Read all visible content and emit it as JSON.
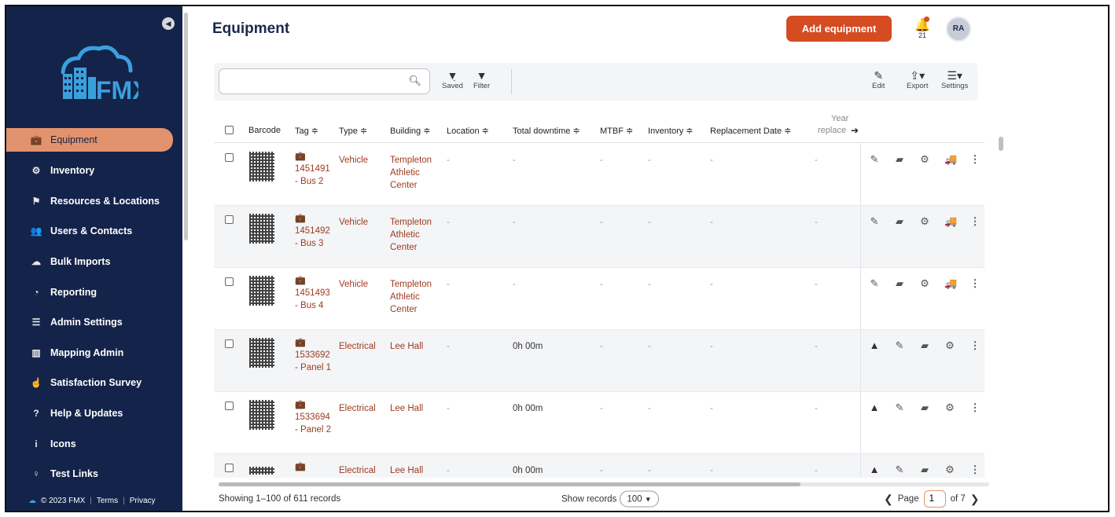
{
  "sidebar": {
    "logo_text": "FMX",
    "items": [
      {
        "label": "Equipment",
        "icon": "briefcase-icon",
        "glyph": "💼",
        "active": true
      },
      {
        "label": "Inventory",
        "icon": "cubes-icon",
        "glyph": "⚙"
      },
      {
        "label": "Resources & Locations",
        "icon": "flag-icon",
        "glyph": "⚑"
      },
      {
        "label": "Users & Contacts",
        "icon": "users-icon",
        "glyph": "👥"
      },
      {
        "label": "Bulk Imports",
        "icon": "cloud-upload-icon",
        "glyph": "☁"
      },
      {
        "label": "Reporting",
        "icon": "pie-chart-icon",
        "glyph": "◔"
      },
      {
        "label": "Admin Settings",
        "icon": "sliders-icon",
        "glyph": "☰"
      },
      {
        "label": "Mapping Admin",
        "icon": "map-icon",
        "glyph": "▥"
      },
      {
        "label": "Satisfaction Survey",
        "icon": "thumbs-up-icon",
        "glyph": "☝"
      },
      {
        "label": "Help & Updates",
        "icon": "question-icon",
        "glyph": "?"
      },
      {
        "label": "Icons",
        "icon": "info-icon",
        "glyph": "i"
      },
      {
        "label": "Test Links",
        "icon": "lightbulb-icon",
        "glyph": "♀"
      }
    ],
    "footer": {
      "copyright": "© 2023 FMX",
      "terms": "Terms",
      "privacy": "Privacy"
    }
  },
  "header": {
    "title": "Equipment",
    "add_button": "Add equipment",
    "notification_count": "21",
    "avatar_initials": "RA"
  },
  "toolbar": {
    "search_value": "",
    "saved_label": "Saved",
    "filter_label": "Filter",
    "edit_label": "Edit",
    "export_label": "Export",
    "settings_label": "Settings"
  },
  "table": {
    "columns": [
      "Barcode",
      "Tag ≑",
      "Type ≑",
      "Building ≑",
      "Location ≑",
      "Total downtime ≑",
      "MTBF ≑",
      "Inventory ≑",
      "Replacement Date ≑",
      "Year",
      "replace"
    ],
    "rows": [
      {
        "tag_id": "1451491",
        "tag_name": "- Bus 2",
        "type": "Vehicle",
        "building": [
          "Templeton",
          "Athletic",
          "Center"
        ],
        "location": "-",
        "downtime": "-",
        "mtbf": "-",
        "inventory": "-",
        "replacement": "-",
        "year": "-",
        "warning": false
      },
      {
        "tag_id": "1451492",
        "tag_name": "- Bus 3",
        "type": "Vehicle",
        "building": [
          "Templeton",
          "Athletic",
          "Center"
        ],
        "location": "-",
        "downtime": "-",
        "mtbf": "-",
        "inventory": "-",
        "replacement": "-",
        "year": "-",
        "warning": false
      },
      {
        "tag_id": "1451493",
        "tag_name": "- Bus 4",
        "type": "Vehicle",
        "building": [
          "Templeton",
          "Athletic",
          "Center"
        ],
        "location": "-",
        "downtime": "-",
        "mtbf": "-",
        "inventory": "-",
        "replacement": "-",
        "year": "-",
        "warning": false
      },
      {
        "tag_id": "1533692",
        "tag_name": "- Panel 1",
        "type": "Electrical",
        "building": [
          "Lee Hall"
        ],
        "location": "-",
        "downtime": "0h 00m",
        "mtbf": "-",
        "inventory": "-",
        "replacement": "-",
        "year": "-",
        "warning": true
      },
      {
        "tag_id": "1533694",
        "tag_name": "- Panel 2",
        "type": "Electrical",
        "building": [
          "Lee Hall"
        ],
        "location": "-",
        "downtime": "0h 00m",
        "mtbf": "-",
        "inventory": "-",
        "replacement": "-",
        "year": "-",
        "warning": true
      },
      {
        "tag_id": "",
        "tag_name": "",
        "type": "Electrical",
        "building": [
          "Lee Hall"
        ],
        "location": "-",
        "downtime": "0h 00m",
        "mtbf": "-",
        "inventory": "-",
        "replacement": "-",
        "year": "-",
        "warning": true
      }
    ]
  },
  "footer": {
    "records_text": "Showing 1–100 of 611 records",
    "show_records_label": "Show records",
    "show_records_value": "100",
    "page_label": "Page",
    "page_value": "1",
    "page_total": "of 7"
  },
  "colors": {
    "sidebar_bg": "#14234a",
    "accent": "#d54b22",
    "active_nav": "#e2936d",
    "link": "#9c3b1f"
  }
}
